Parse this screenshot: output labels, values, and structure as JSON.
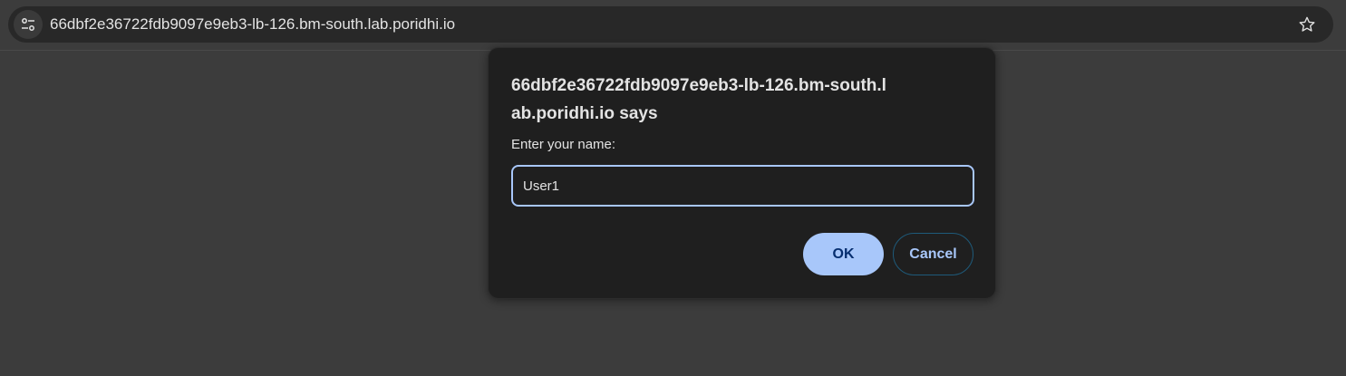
{
  "browser": {
    "url": "66dbf2e36722fdb9097e9eb3-lb-126.bm-south.lab.poridhi.io",
    "site_info_icon": "tune-icon",
    "bookmark_icon": "star-outline-icon"
  },
  "dialog": {
    "title": "66dbf2e36722fdb9097e9eb3-lb-126.bm-south.lab.poridhi.io says",
    "message": "Enter your name:",
    "input_value": "User1",
    "ok_label": "OK",
    "cancel_label": "Cancel"
  },
  "colors": {
    "accent": "#a8c7fa",
    "dialog_bg": "#1f1f1f",
    "page_bg": "#3c3c3c"
  }
}
